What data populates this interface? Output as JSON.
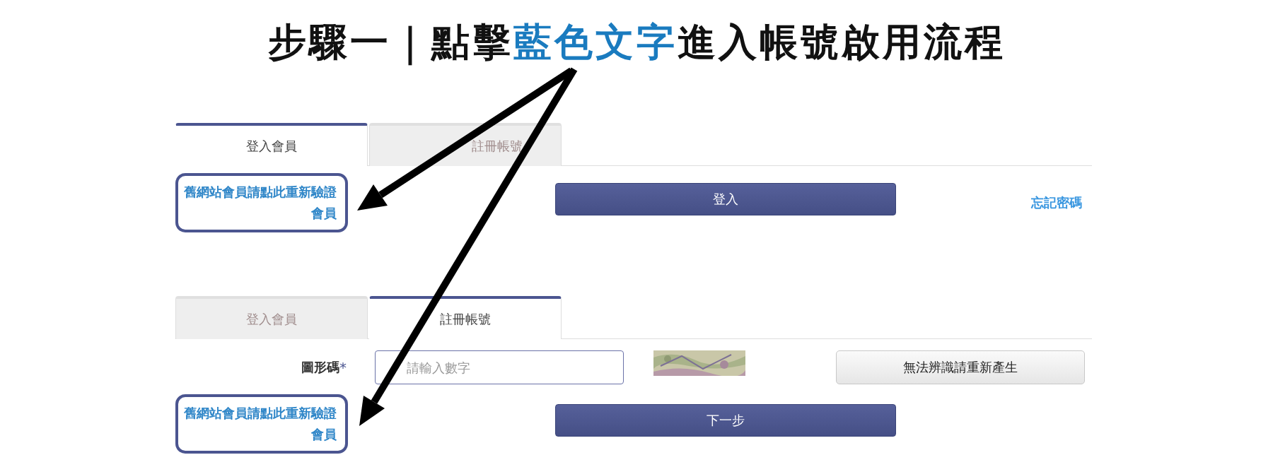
{
  "title": {
    "parts": [
      {
        "text": "步驟一｜點擊",
        "highlight": false
      },
      {
        "text": "藍色文字",
        "highlight": true
      },
      {
        "text": "進入帳號啟用流程",
        "highlight": false
      }
    ]
  },
  "panels": [
    {
      "kind": "login",
      "tabs": [
        {
          "label": "登入會員",
          "selected": true
        },
        {
          "label": "註冊帳號",
          "selected": false
        }
      ],
      "legacy_link": {
        "text": "舊網站會員請點此重新驗證會員",
        "highlighted": true
      },
      "primary_button": "登入",
      "forgot_link": "忘記密碼"
    },
    {
      "kind": "register",
      "tabs": [
        {
          "label": "登入會員",
          "selected": false
        },
        {
          "label": "註冊帳號",
          "selected": true
        }
      ],
      "captcha_field": {
        "label": "圖形碼",
        "required_mark": "*",
        "placeholder": "請輸入數字"
      },
      "captcha_image": {
        "kind": "picture"
      },
      "refresh_button": "無法辨識請重新產生",
      "legacy_link": {
        "text": "舊網站會員請點此重新驗證會員",
        "highlighted": true
      },
      "primary_button": "下一步"
    }
  ]
}
